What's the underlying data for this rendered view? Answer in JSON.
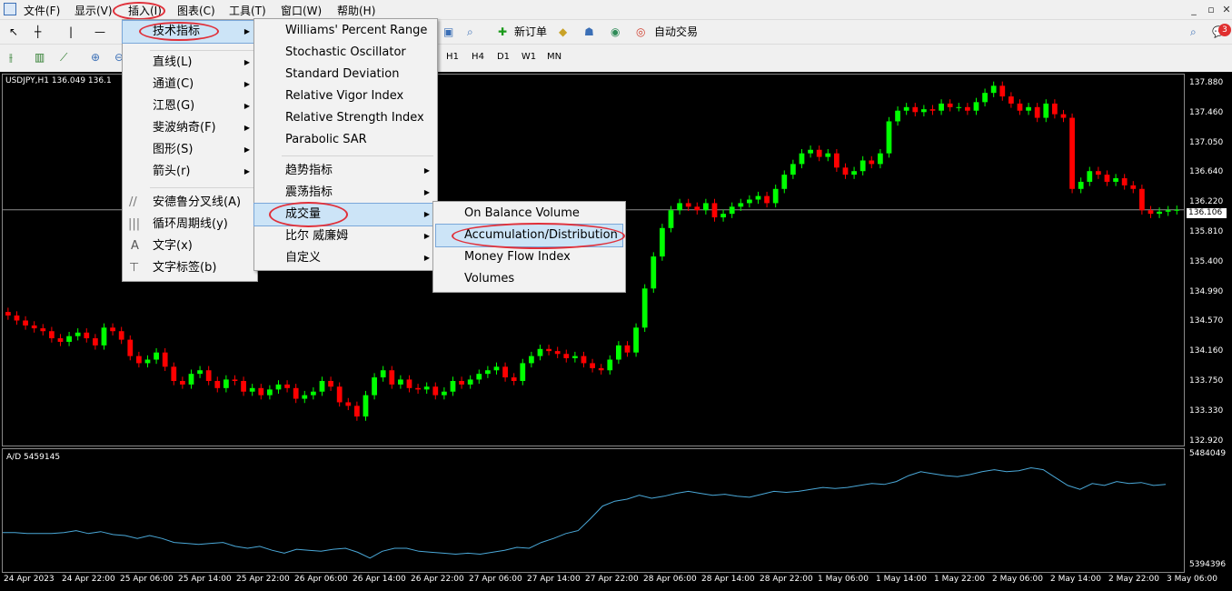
{
  "menubar": {
    "items": [
      "文件(F)",
      "显示(V)",
      "插入(I)",
      "图表(C)",
      "工具(T)",
      "窗口(W)",
      "帮助(H)"
    ]
  },
  "toolbar": {
    "new_order": "新订单",
    "auto_trading": "自动交易",
    "timeframes": [
      "H1",
      "H4",
      "D1",
      "W1",
      "MN"
    ],
    "notification_badge": "3"
  },
  "insert_menu": {
    "items": [
      "技术指标",
      "直线(L)",
      "通道(C)",
      "江恩(G)",
      "斐波纳奇(F)",
      "图形(S)",
      "箭头(r)",
      "安德鲁分叉线(A)",
      "循环周期线(y)",
      "文字(x)",
      "文字标签(b)"
    ]
  },
  "indicators_menu": {
    "items": [
      "Williams' Percent Range",
      "Stochastic Oscillator",
      "Standard Deviation",
      "Relative Vigor Index",
      "Relative Strength Index",
      "Parabolic SAR",
      "趋势指标",
      "震荡指标",
      "成交量",
      "比尔 威廉姆",
      "自定义"
    ]
  },
  "volume_menu": {
    "items": [
      "On Balance Volume",
      "Accumulation/Distribution",
      "Money Flow Index",
      "Volumes"
    ]
  },
  "chart": {
    "title": "USDJPY,H1  136.049 136.1",
    "indicator_title": "A/D 5459145",
    "current_price": "136.106",
    "price_labels": [
      "137.880",
      "137.460",
      "137.050",
      "136.640",
      "136.220",
      "135.810",
      "135.400",
      "134.990",
      "134.570",
      "134.160",
      "133.750",
      "133.330",
      "132.920"
    ],
    "indicator_labels": [
      "5484049",
      "5394396"
    ],
    "time_labels": [
      "24 Apr 2023",
      "24 Apr 22:00",
      "25 Apr 06:00",
      "25 Apr 14:00",
      "25 Apr 22:00",
      "26 Apr 06:00",
      "26 Apr 14:00",
      "26 Apr 22:00",
      "27 Apr 06:00",
      "27 Apr 14:00",
      "27 Apr 22:00",
      "28 Apr 06:00",
      "28 Apr 14:00",
      "28 Apr 22:00",
      "1 May 06:00",
      "1 May 14:00",
      "1 May 22:00",
      "2 May 06:00",
      "2 May 14:00",
      "2 May 22:00",
      "3 May 06:00"
    ],
    "colors": {
      "bull": "#00ff00",
      "bear": "#ff0000",
      "ad_line": "#4aa8d8",
      "bg": "#000000",
      "highlight_oval": "#e0303a"
    }
  },
  "chart_data": {
    "type": "candlestick",
    "symbol": "USDJPY",
    "timeframe": "H1",
    "ylim": [
      132.92,
      137.88
    ],
    "closes": [
      134.62,
      134.55,
      134.48,
      134.44,
      134.4,
      134.3,
      134.25,
      134.33,
      134.38,
      134.3,
      134.2,
      134.45,
      134.4,
      134.28,
      134.05,
      133.95,
      134.0,
      134.1,
      133.9,
      133.7,
      133.65,
      133.8,
      133.85,
      133.7,
      133.6,
      133.72,
      133.7,
      133.55,
      133.6,
      133.5,
      133.58,
      133.65,
      133.6,
      133.45,
      133.5,
      133.55,
      133.7,
      133.62,
      133.4,
      133.35,
      133.2,
      133.5,
      133.75,
      133.85,
      133.65,
      133.72,
      133.6,
      133.58,
      133.62,
      133.5,
      133.55,
      133.7,
      133.65,
      133.72,
      133.8,
      133.85,
      133.9,
      133.75,
      133.7,
      133.95,
      134.05,
      134.15,
      134.12,
      134.08,
      134.02,
      134.05,
      133.95,
      133.88,
      133.85,
      134.0,
      134.2,
      134.1,
      134.45,
      135.0,
      135.45,
      135.85,
      136.1,
      136.2,
      136.15,
      136.1,
      136.2,
      136.0,
      136.05,
      136.15,
      136.2,
      136.25,
      136.3,
      136.2,
      136.4,
      136.6,
      136.75,
      136.9,
      136.95,
      136.85,
      136.9,
      136.7,
      136.6,
      136.65,
      136.8,
      136.75,
      136.9,
      137.35,
      137.5,
      137.55,
      137.48,
      137.52,
      137.5,
      137.6,
      137.55,
      137.55,
      137.5,
      137.62,
      137.75,
      137.85,
      137.7,
      137.6,
      137.5,
      137.55,
      137.4,
      137.6,
      137.45,
      137.4,
      136.4,
      136.5,
      136.65,
      136.6,
      136.5,
      136.55,
      136.45,
      136.4,
      136.1,
      136.05,
      136.08,
      136.1,
      136.106
    ],
    "ad_line": [
      0.28,
      0.28,
      0.27,
      0.27,
      0.27,
      0.28,
      0.3,
      0.27,
      0.29,
      0.26,
      0.25,
      0.22,
      0.25,
      0.22,
      0.18,
      0.17,
      0.16,
      0.17,
      0.18,
      0.14,
      0.12,
      0.14,
      0.1,
      0.07,
      0.11,
      0.1,
      0.09,
      0.11,
      0.12,
      0.08,
      0.02,
      0.09,
      0.12,
      0.12,
      0.09,
      0.08,
      0.07,
      0.06,
      0.07,
      0.06,
      0.08,
      0.1,
      0.13,
      0.12,
      0.18,
      0.22,
      0.27,
      0.3,
      0.42,
      0.55,
      0.6,
      0.62,
      0.66,
      0.63,
      0.65,
      0.68,
      0.7,
      0.68,
      0.66,
      0.67,
      0.65,
      0.64,
      0.67,
      0.7,
      0.69,
      0.7,
      0.72,
      0.74,
      0.73,
      0.74,
      0.76,
      0.78,
      0.77,
      0.8,
      0.86,
      0.9,
      0.88,
      0.86,
      0.85,
      0.87,
      0.9,
      0.92,
      0.9,
      0.91,
      0.94,
      0.92,
      0.84,
      0.76,
      0.72,
      0.78,
      0.76,
      0.8,
      0.78,
      0.79,
      0.76,
      0.77
    ]
  }
}
